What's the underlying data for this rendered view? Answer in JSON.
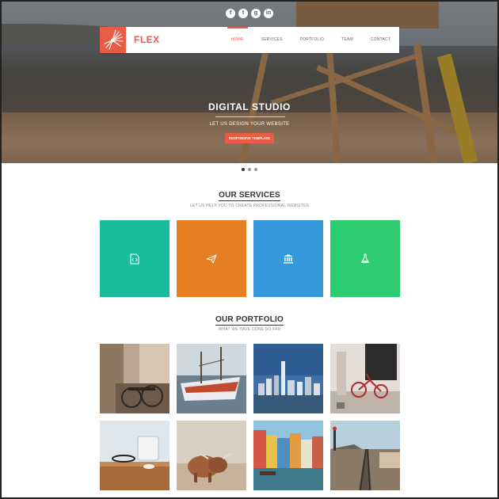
{
  "brand": {
    "name": "FLEX"
  },
  "social": [
    {
      "name": "facebook-icon",
      "glyph": "f"
    },
    {
      "name": "twitter-icon",
      "glyph": "t"
    },
    {
      "name": "google-plus-icon",
      "glyph": "g"
    },
    {
      "name": "linkedin-icon",
      "glyph": "in"
    }
  ],
  "nav": {
    "items": [
      "HOME",
      "SERVICES",
      "PORTFOLIO",
      "TEAM",
      "CONTACT"
    ],
    "active": "HOME"
  },
  "hero": {
    "title": "DIGITAL STUDIO",
    "subtitle": "LET US DESIGN YOUR WEBSITE",
    "button": "RESPONSIVE TEMPLATE",
    "slides": 3,
    "active_slide": 1
  },
  "services": {
    "title": "OUR SERVICES",
    "subtitle": "LET US HELP YOU TO CREATE PROFESSIONAL WEBSITES",
    "tiles": [
      {
        "icon": "code-file-icon",
        "color": "#1abc9c"
      },
      {
        "icon": "paper-plane-icon",
        "color": "#e67e22"
      },
      {
        "icon": "bank-icon",
        "color": "#3498db"
      },
      {
        "icon": "flask-icon",
        "color": "#2ecc71"
      }
    ]
  },
  "portfolio": {
    "title": "OUR PORTFOLIO",
    "subtitle": "WHAT WE HAVE DONE SO FAR",
    "items": [
      "bicycles-street-photo",
      "boat-harbor-photo",
      "city-skyline-photo",
      "red-bicycle-door-photo",
      "desk-glasses-photo",
      "highland-cow-photo",
      "canal-houses-photo",
      "railway-tracks-photo"
    ]
  },
  "colors": {
    "accent": "#e95d48"
  }
}
